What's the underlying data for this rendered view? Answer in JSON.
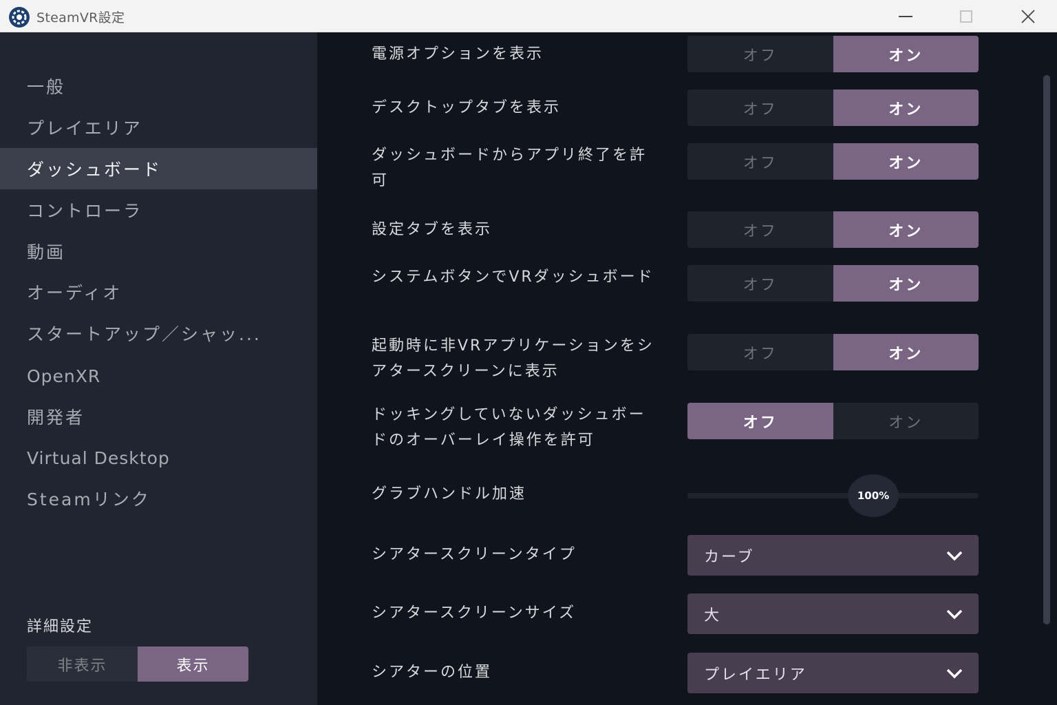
{
  "window": {
    "title": "SteamVR設定",
    "icon": "steamvr-gear-icon"
  },
  "sidebar": {
    "items": [
      {
        "label": "一般"
      },
      {
        "label": "プレイエリア"
      },
      {
        "label": "ダッシュボード",
        "active": true
      },
      {
        "label": "コントローラ"
      },
      {
        "label": "動画"
      },
      {
        "label": "オーディオ"
      },
      {
        "label": "スタートアップ／シャッ..."
      },
      {
        "label": "OpenXR"
      },
      {
        "label": "開発者"
      },
      {
        "label": "Virtual Desktop"
      },
      {
        "label": "Steamリンク"
      }
    ],
    "advanced": {
      "label": "詳細設定",
      "off_label": "非表示",
      "on_label": "表示",
      "selected": "表示"
    }
  },
  "settings": {
    "toggle_off": "オフ",
    "toggle_on": "オン",
    "rows": [
      {
        "label": "電源オプションを表示",
        "value": "オン"
      },
      {
        "label": "デスクトップタブを表示",
        "value": "オン"
      },
      {
        "label": "ダッシュボードからアプリ終了を許可",
        "value": "オン"
      },
      {
        "label": "設定タブを表示",
        "value": "オン"
      },
      {
        "label": "システムボタンでVRダッシュボード",
        "value": "オン"
      },
      {
        "label": "起動時に非VRアプリケーションをシアタースクリーンに表示",
        "value": "オン"
      },
      {
        "label": "ドッキングしていないダッシュボードのオーバーレイ操作を許可",
        "value": "オフ"
      }
    ],
    "grab_handle": {
      "label": "グラブハンドル加速",
      "value_text": "100%",
      "value": 1.0
    },
    "theater_type": {
      "label": "シアタースクリーンタイプ",
      "value": "カーブ"
    },
    "theater_size": {
      "label": "シアタースクリーンサイズ",
      "value": "大"
    },
    "theater_position": {
      "label": "シアターの位置",
      "value": "プレイエリア"
    }
  },
  "colors": {
    "accent": "#7a6684",
    "dropdown_bg": "#493e4f",
    "sidebar_bg": "#212530",
    "main_bg": "#10151d"
  }
}
